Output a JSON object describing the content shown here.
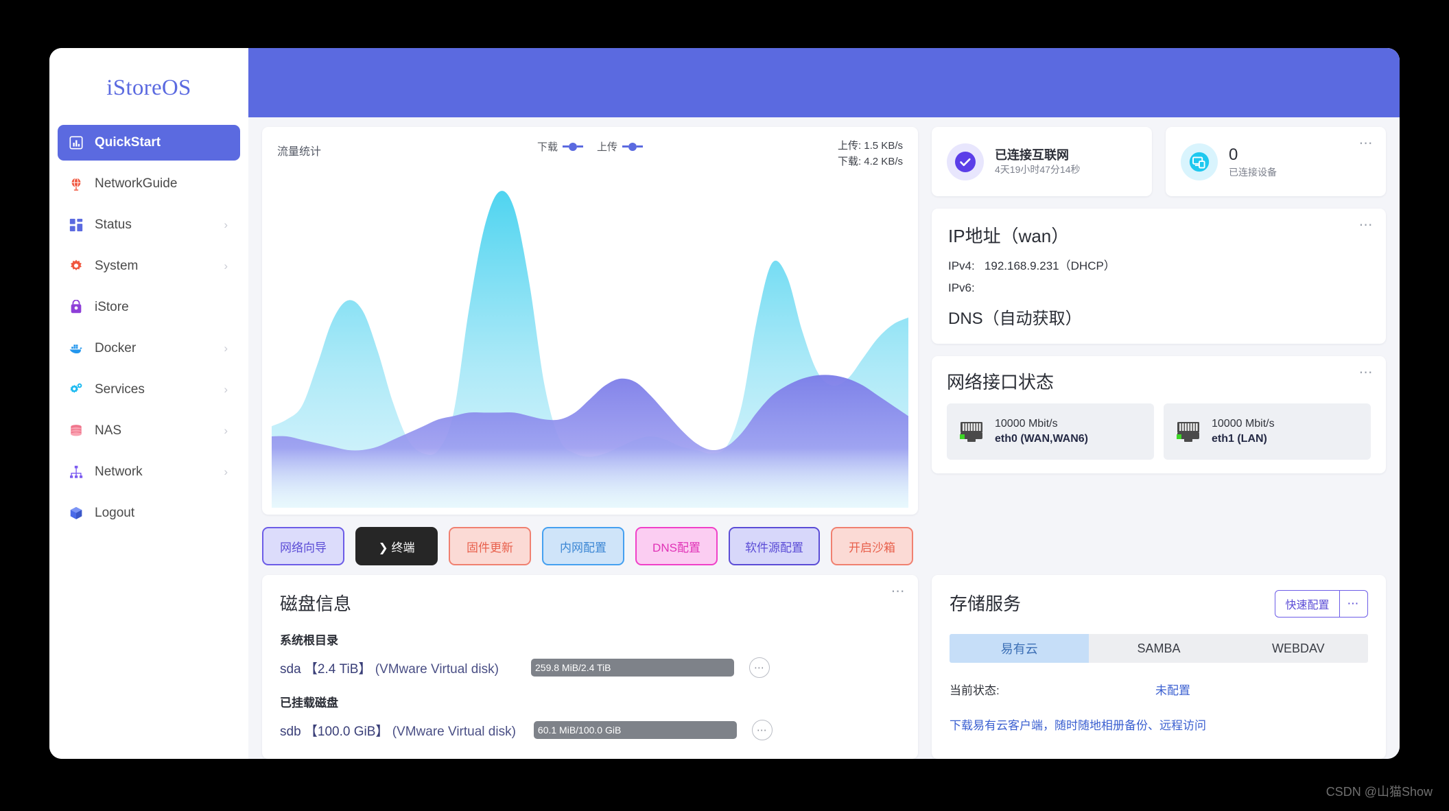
{
  "brand": "iStoreOS",
  "sidebar": {
    "items": [
      {
        "label": "QuickStart",
        "icon": "chart-bar-icon",
        "active": true,
        "chevron": false
      },
      {
        "label": "NetworkGuide",
        "icon": "globe-icon",
        "active": false,
        "chevron": false
      },
      {
        "label": "Status",
        "icon": "dashboard-icon",
        "active": false,
        "chevron": true
      },
      {
        "label": "System",
        "icon": "gear-icon",
        "active": false,
        "chevron": true
      },
      {
        "label": "iStore",
        "icon": "shopping-bag-icon",
        "active": false,
        "chevron": false
      },
      {
        "label": "Docker",
        "icon": "docker-whale-icon",
        "active": false,
        "chevron": true
      },
      {
        "label": "Services",
        "icon": "gears-icon",
        "active": false,
        "chevron": true
      },
      {
        "label": "NAS",
        "icon": "database-icon",
        "active": false,
        "chevron": true
      },
      {
        "label": "Network",
        "icon": "sitemap-icon",
        "active": false,
        "chevron": true
      },
      {
        "label": "Logout",
        "icon": "cube-icon",
        "active": false,
        "chevron": false
      }
    ]
  },
  "traffic": {
    "title": "流量统计",
    "legend": [
      {
        "label": "下载",
        "color": "#5b6ae0"
      },
      {
        "label": "上传",
        "color": "#5b6ae0"
      }
    ],
    "upload_rate": "上传: 1.5 KB/s",
    "download_rate": "下载: 4.2 KB/s"
  },
  "chart_data": {
    "type": "area",
    "title": "流量统计",
    "xlabel": "",
    "ylabel": "",
    "legend_position": "top-center",
    "grid": false,
    "series": [
      {
        "name": "下载",
        "color": "#8ee4f5",
        "unit": "KB/s",
        "current": 4.2,
        "values": [
          24,
          26,
          30,
          42,
          55,
          61,
          58,
          46,
          31,
          20,
          16,
          17,
          28,
          58,
          82,
          93,
          88,
          66,
          36,
          20,
          16,
          15,
          16,
          18,
          20,
          21,
          20,
          18,
          17,
          16,
          18,
          30,
          55,
          72,
          68,
          52,
          40,
          36,
          38,
          44,
          50,
          54,
          56
        ]
      },
      {
        "name": "上传",
        "color": "#7b7ce8",
        "unit": "KB/s",
        "current": 1.5,
        "values": [
          21,
          21,
          20,
          19,
          18,
          17,
          17,
          18,
          20,
          22,
          24,
          26,
          27,
          28,
          28,
          28,
          28,
          27,
          26,
          26,
          28,
          32,
          36,
          38,
          37,
          33,
          28,
          23,
          19,
          17,
          18,
          22,
          28,
          33,
          36,
          38,
          39,
          39,
          38,
          36,
          33,
          30,
          27
        ]
      }
    ],
    "ylim": [
      0,
      100
    ]
  },
  "actions": [
    {
      "label": "网络向导",
      "style": "act-wizard"
    },
    {
      "label": "❯ 终端",
      "style": "act-terminal"
    },
    {
      "label": "固件更新",
      "style": "act-firmware"
    },
    {
      "label": "内网配置",
      "style": "act-lan"
    },
    {
      "label": "DNS配置",
      "style": "act-dns"
    },
    {
      "label": "软件源配置",
      "style": "act-repo"
    },
    {
      "label": "开启沙箱",
      "style": "act-sandbox"
    }
  ],
  "status_cards": {
    "internet": {
      "title": "已连接互联网",
      "uptime": "4天19小时47分14秒",
      "icon": "check-circle-icon"
    },
    "devices": {
      "count": "0",
      "label": "已连接设备",
      "icon": "devices-icon",
      "more": "⋯"
    }
  },
  "ip_card": {
    "title": "IP地址（wan）",
    "ipv4_label": "IPv4:",
    "ipv4_value": "192.168.9.231（DHCP）",
    "ipv6_label": "IPv6:",
    "ipv6_value": "",
    "dns_title": "DNS（自动获取）",
    "more": "⋯"
  },
  "netif_card": {
    "title": "网络接口状态",
    "more": "⋯",
    "interfaces": [
      {
        "speed": "10000 Mbit/s",
        "name": "eth0 (WAN,WAN6)",
        "link": "up"
      },
      {
        "speed": "10000 Mbit/s",
        "name": "eth1 (LAN)",
        "link": "up"
      }
    ]
  },
  "disk_card": {
    "title": "磁盘信息",
    "more": "⋯",
    "groups": [
      {
        "heading": "系统根目录",
        "rows": [
          {
            "device": "sda",
            "size": "【2.4 TiB】",
            "model": "(VMware Virtual disk)",
            "usage": "259.8 MiB/2.4 TiB",
            "menu": "⋯"
          }
        ]
      },
      {
        "heading": "已挂载磁盘",
        "rows": [
          {
            "device": "sdb",
            "size": "【100.0 GiB】",
            "model": "(VMware Virtual disk)",
            "usage": "60.1 MiB/100.0 GiB",
            "menu": "⋯"
          }
        ]
      }
    ]
  },
  "svc_card": {
    "title": "存储服务",
    "quick_config": "快速配置",
    "more": "⋯",
    "tabs": [
      {
        "label": "易有云",
        "active": true
      },
      {
        "label": "SAMBA",
        "active": false
      },
      {
        "label": "WEBDAV",
        "active": false
      }
    ],
    "status_label": "当前状态:",
    "status_value": "未配置",
    "promo_link": "下载易有云客户端，随时随地相册备份、远程访问"
  },
  "watermark": "CSDN @山猫Show",
  "colors": {
    "accent": "#5b6ae0",
    "topbar": "#5b6ae0",
    "download_area": "#8ee4f5",
    "upload_area": "#7b7ce8",
    "page_bg": "#f4f5f9"
  }
}
